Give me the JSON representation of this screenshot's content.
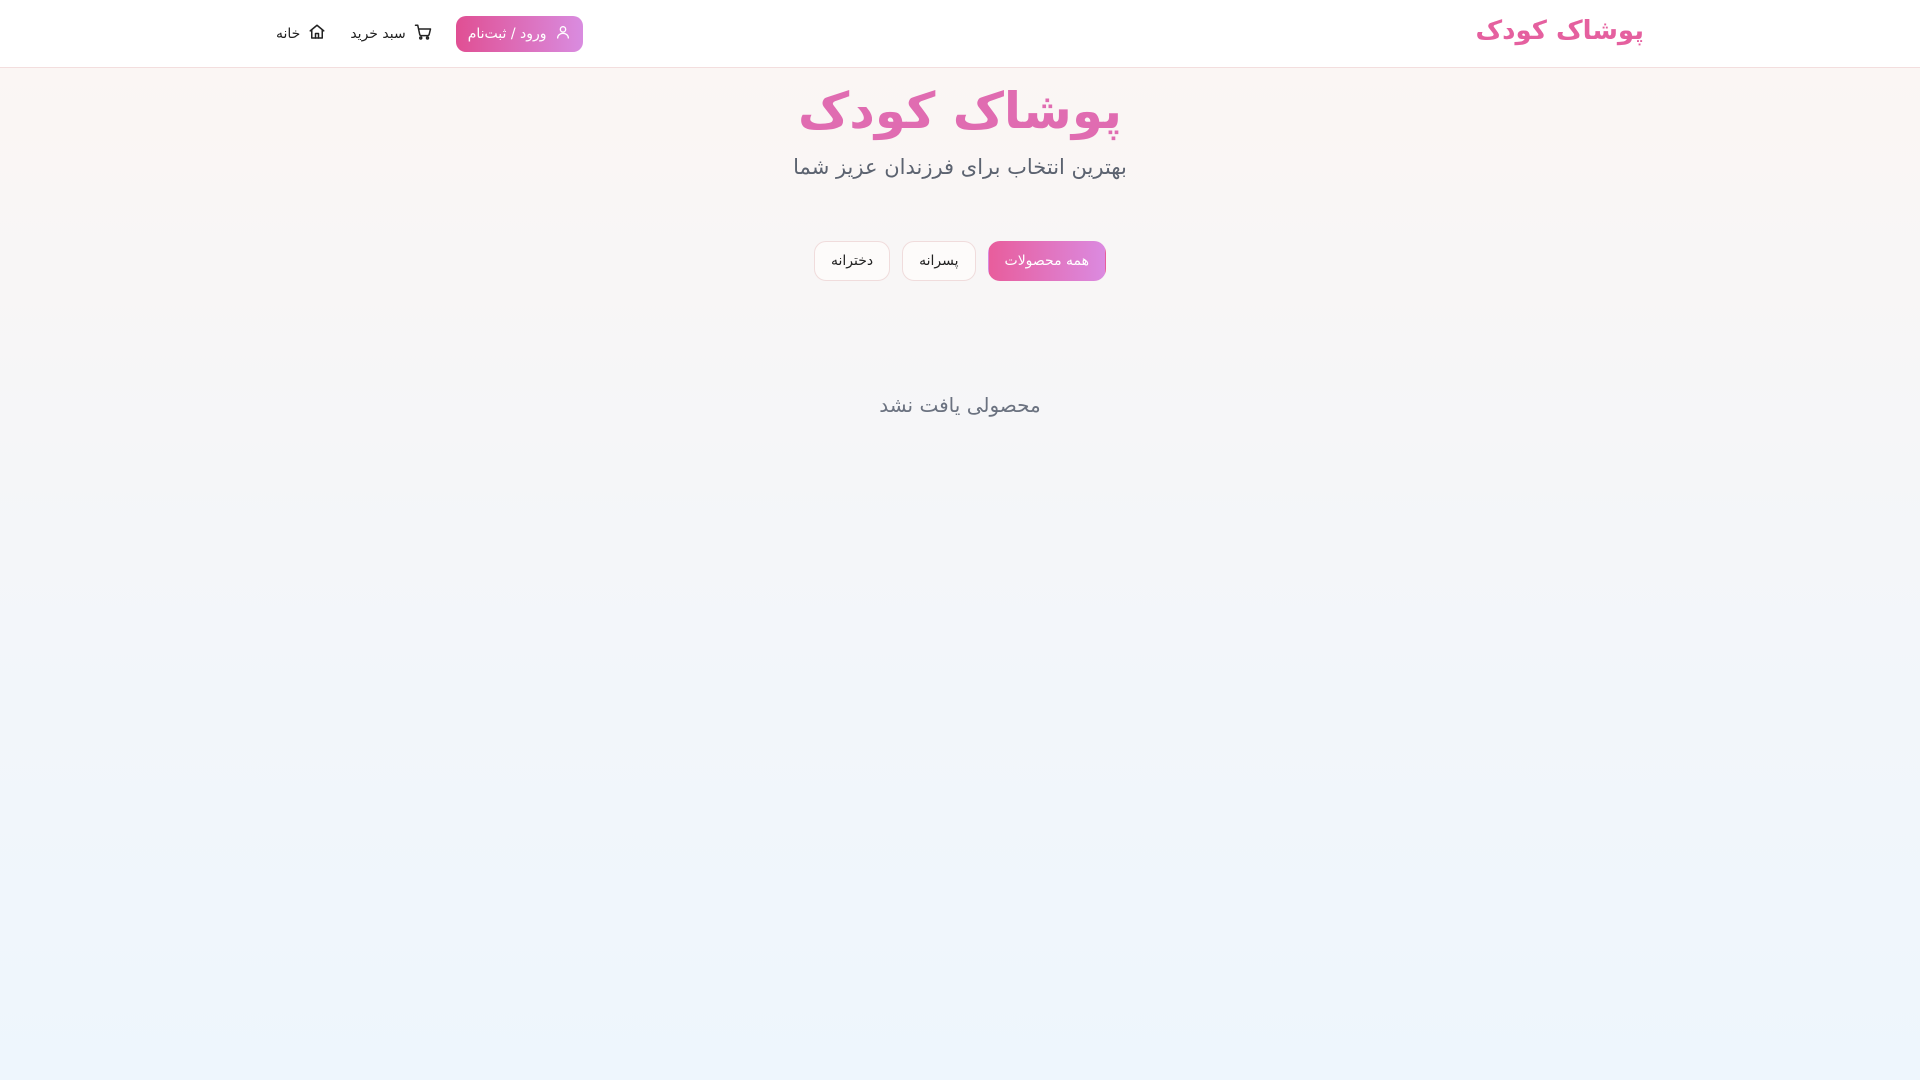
{
  "navbar": {
    "brand": "پوشاک کودک",
    "links": [
      {
        "label": "خانه",
        "icon": "home-icon"
      },
      {
        "label": "سبد خرید",
        "icon": "cart-icon"
      }
    ],
    "login_label": "ورود / ثبت‌نام",
    "login_icon": "user-icon"
  },
  "hero": {
    "title": "پوشاک کودک",
    "subtitle": "بهترین انتخاب برای فرزندان عزیز شما"
  },
  "filters": {
    "items": [
      {
        "label": "همه محصولات",
        "active": true
      },
      {
        "label": "پسرانه",
        "active": false
      },
      {
        "label": "دخترانه",
        "active": false
      }
    ]
  },
  "products": {
    "empty_message": "محصولی یافت نشد"
  },
  "colors": {
    "brand": "#e5609f",
    "gradient_start": "#e04f93",
    "gradient_end": "#d98ce0"
  }
}
